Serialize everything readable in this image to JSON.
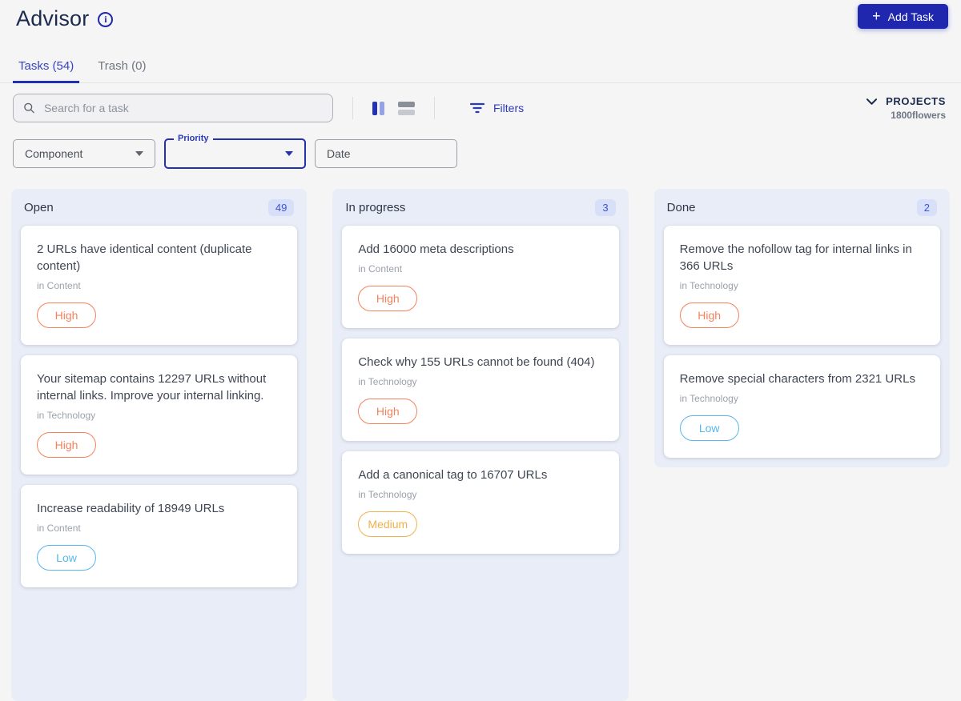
{
  "header": {
    "title": "Advisor",
    "add_task_label": "Add Task",
    "plus": "+"
  },
  "tabs": {
    "tasks": "Tasks (54)",
    "trash": "Trash (0)"
  },
  "toolbar": {
    "search_placeholder": "Search for a task",
    "filters_label": "Filters",
    "projects_label": "PROJECTS",
    "project_name": "1800flowers"
  },
  "filter_fields": {
    "component": "Component",
    "priority": "Priority",
    "date": "Date"
  },
  "colors": {
    "accent_blue": "#1e27ad",
    "link_blue": "#2b3ab8",
    "column_bg": "#e9edf7",
    "badge_bg": "#d7e0f8",
    "badge_text": "#3c55d4",
    "priority_high": "#f5815d",
    "priority_medium": "#eeb14d",
    "priority_low": "#58b7ec"
  },
  "board": {
    "priority_colors": {
      "High": "#f5815d",
      "Medium": "#eeb14d",
      "Low": "#58b7ec"
    },
    "columns": [
      {
        "name": "Open",
        "count": "49",
        "tasks": [
          {
            "title": "2 URLs have identical content (duplicate content)",
            "category": "in Content",
            "priority": "High"
          },
          {
            "title": "Your sitemap contains 12297 URLs without internal links. Improve your internal linking.",
            "category": "in Technology",
            "priority": "High"
          },
          {
            "title": "Increase readability of 18949 URLs",
            "category": "in Content",
            "priority": "Low"
          }
        ]
      },
      {
        "name": "In progress",
        "count": "3",
        "tasks": [
          {
            "title": "Add 16000 meta descriptions",
            "category": "in Content",
            "priority": "High"
          },
          {
            "title": "Check why 155 URLs cannot be found (404)",
            "category": "in Technology",
            "priority": "High"
          },
          {
            "title": "Add a canonical tag to 16707 URLs",
            "category": "in Technology",
            "priority": "Medium"
          }
        ]
      },
      {
        "name": "Done",
        "count": "2",
        "tasks": [
          {
            "title": "Remove the nofollow tag for internal links in 366 URLs",
            "category": "in Technology",
            "priority": "High"
          },
          {
            "title": "Remove special characters from 2321 URLs",
            "category": "in Technology",
            "priority": "Low"
          }
        ]
      }
    ]
  }
}
